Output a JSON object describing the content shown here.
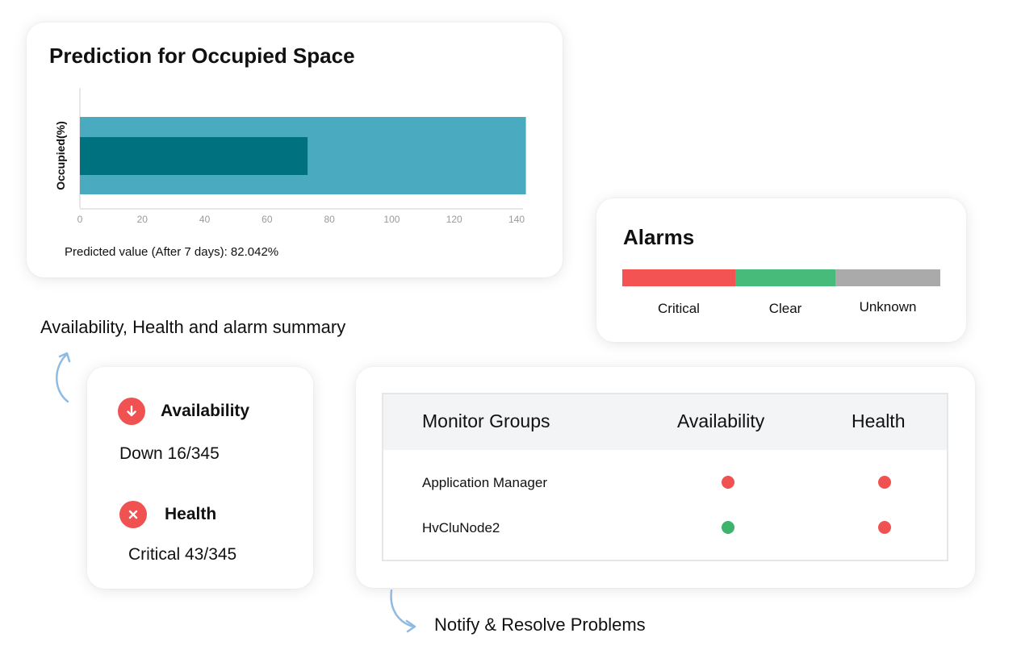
{
  "prediction": {
    "title": "Prediction for Occupied Space",
    "footer": "Predicted value (After 7 days): 82.042%",
    "chart_data": {
      "type": "bar",
      "orientation": "horizontal",
      "ylabel": "Occupied(%)",
      "xlim": [
        0,
        145
      ],
      "xticks": [
        "0",
        "20",
        "40",
        "60",
        "80",
        "100",
        "120",
        "140"
      ],
      "series": [
        {
          "values": [
            143
          ],
          "color": "#4aabc0"
        },
        {
          "values": [
            73
          ],
          "color": "#00727f"
        }
      ]
    }
  },
  "alarms": {
    "title": "Alarms",
    "segments": [
      {
        "label": "Critical",
        "share": 0.355,
        "color": "#f35353"
      },
      {
        "label": "Clear",
        "share": 0.315,
        "color": "#47bb7a"
      },
      {
        "label": "Unknown",
        "share": 0.33,
        "color": "#aaaaaa"
      }
    ]
  },
  "captions": {
    "summary": "Availability, Health and  alarm summary",
    "notify": "Notify & Resolve Problems"
  },
  "status_summary": {
    "availability": {
      "heading": "Availability",
      "value": "Down 16/345",
      "icon": "arrow-down-icon"
    },
    "health": {
      "heading": "Health",
      "value": "Critical 43/345",
      "icon": "close-icon"
    }
  },
  "monitor_groups": {
    "headers": [
      "Monitor Groups",
      "Availability",
      "Health"
    ],
    "rows": [
      {
        "name": "Application Manager",
        "availability": "#f05252",
        "health": "#f05252"
      },
      {
        "name": "HvCluNode2",
        "availability": "#3db36b",
        "health": "#f05252"
      }
    ]
  }
}
